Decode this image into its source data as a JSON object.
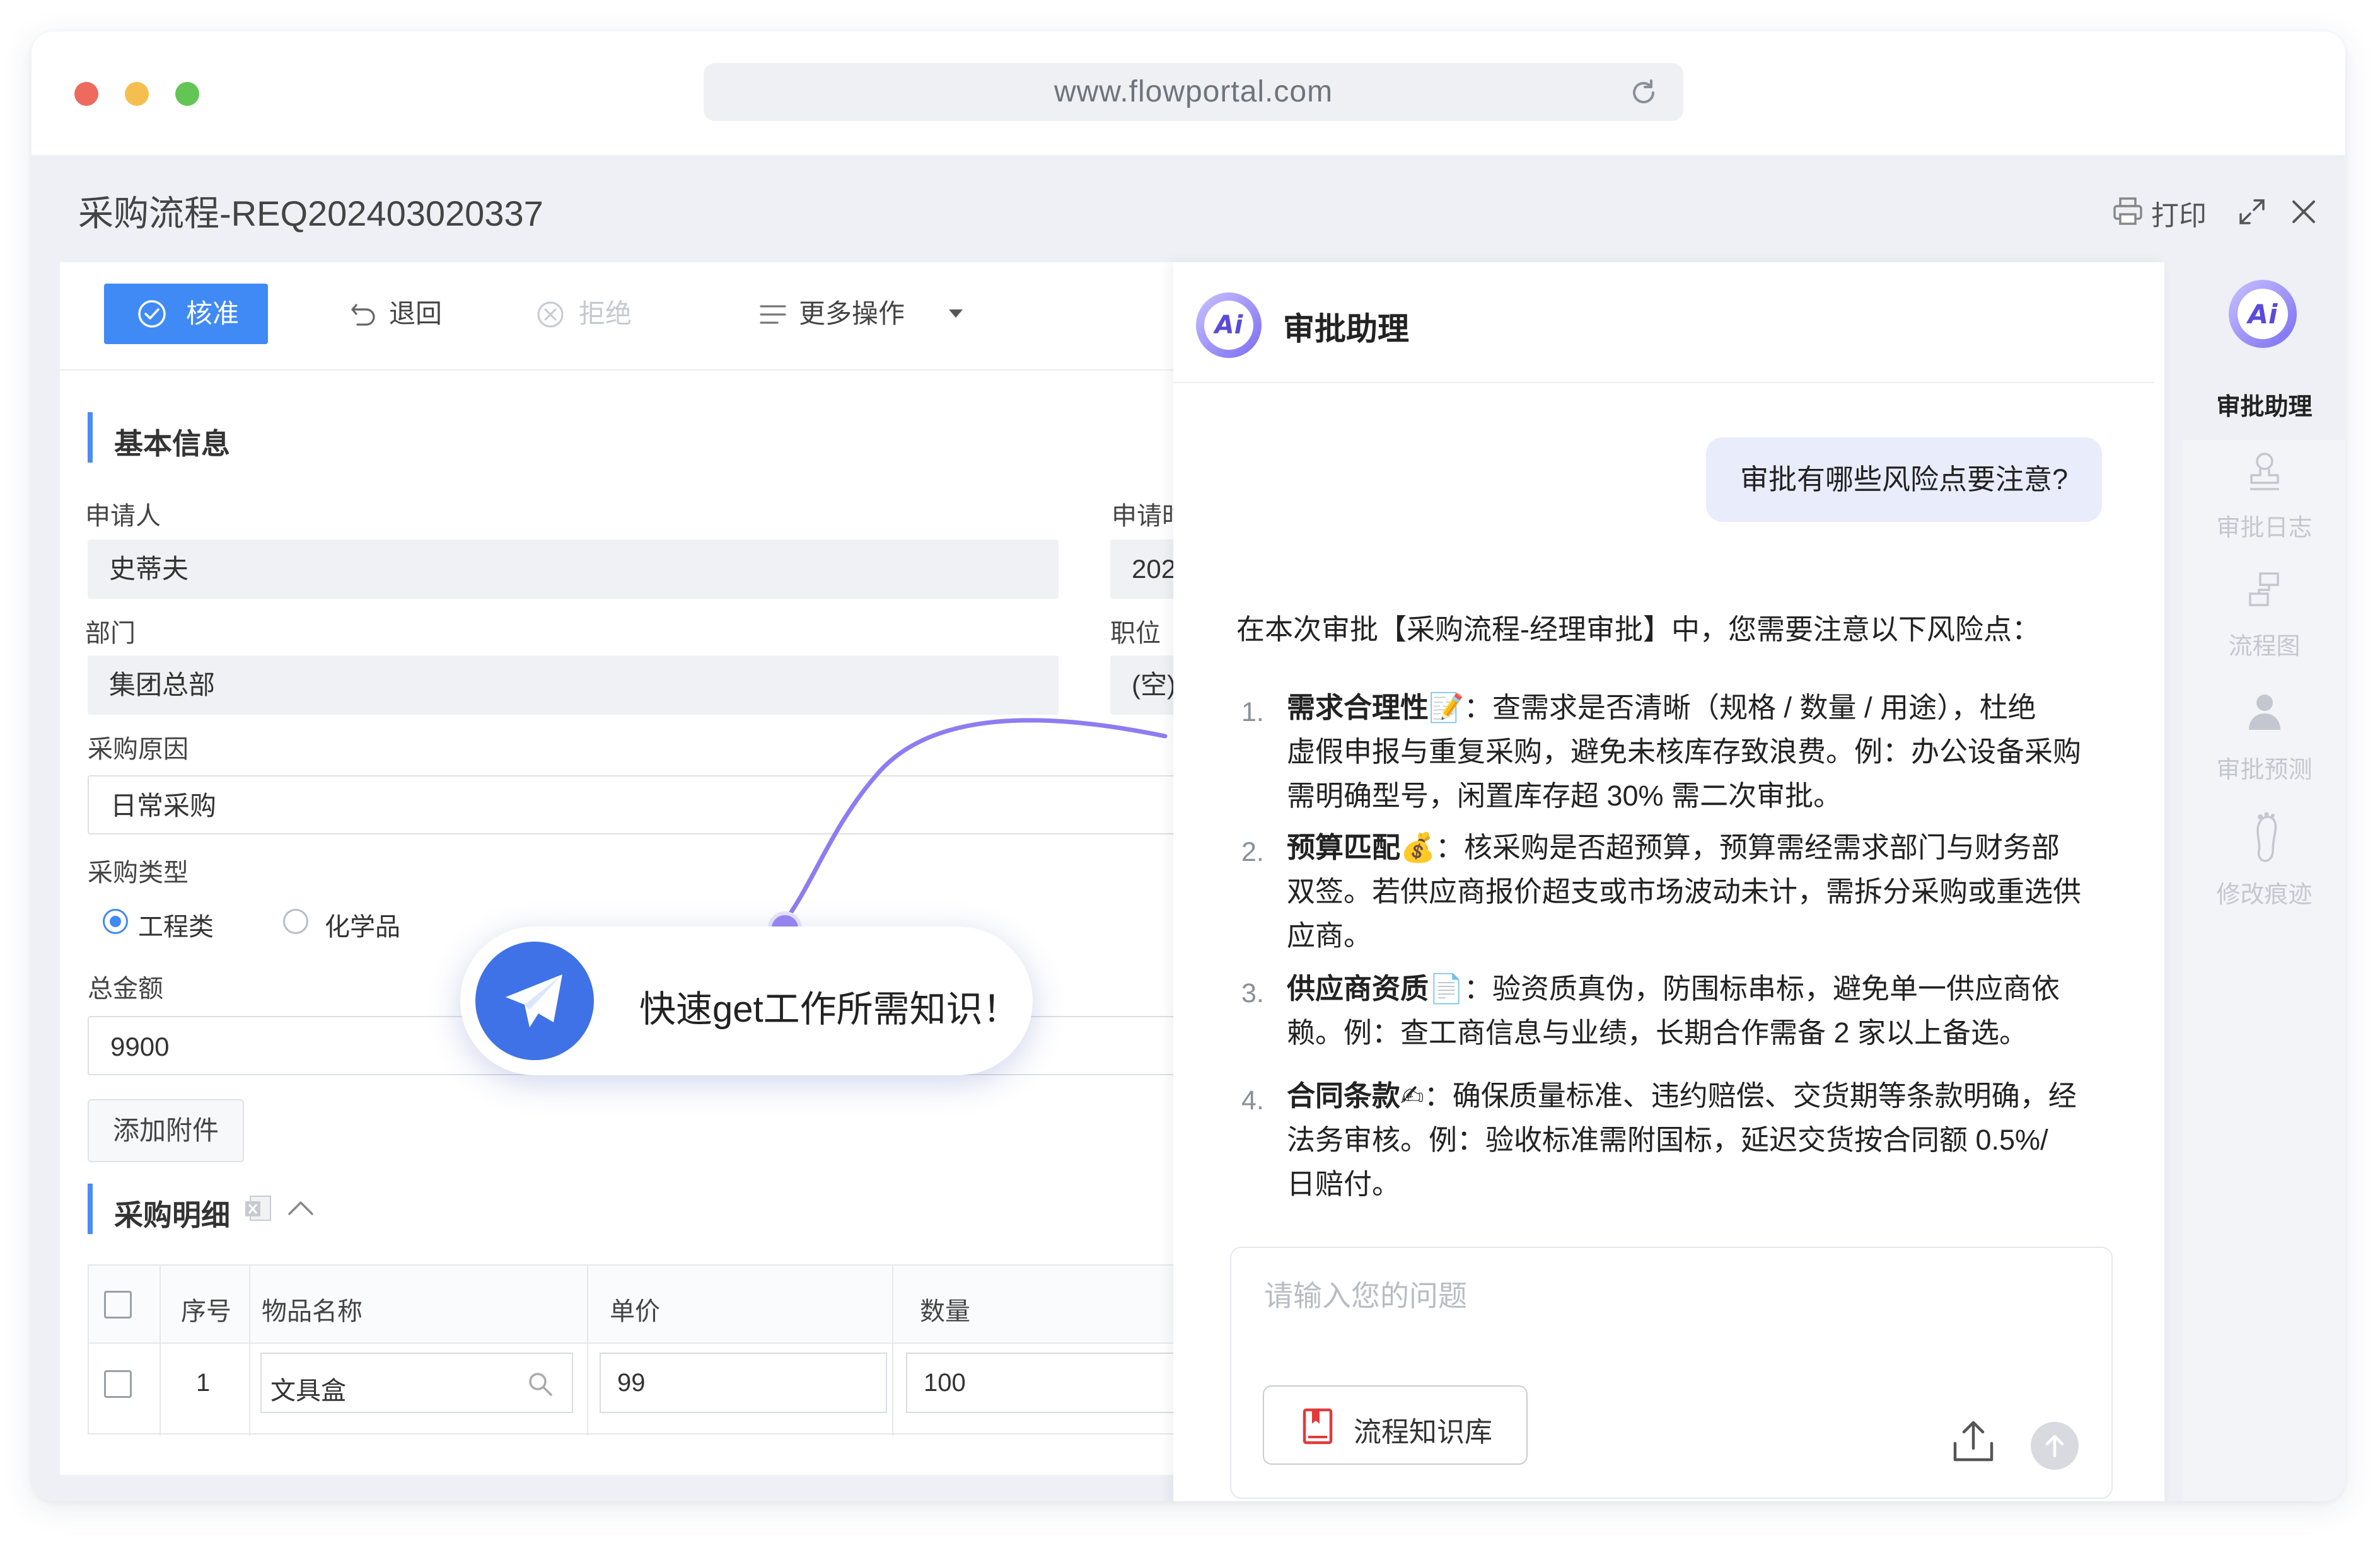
{
  "browser": {
    "url": "www.flowportal.com",
    "dot_colors": [
      "#ee6a5e",
      "#f5bf4f",
      "#62c554"
    ]
  },
  "page": {
    "title": "采购流程-REQ202403020337",
    "print_label": "打印"
  },
  "toolbar": {
    "approve": "核准",
    "return": "退回",
    "reject": "拒绝",
    "more": "更多操作"
  },
  "form": {
    "basic_section": "基本信息",
    "applicant_label": "申请人",
    "applicant_value": "史蒂夫",
    "apply_time_label": "申请时",
    "apply_time_value": "202",
    "dept_label": "部门",
    "dept_value": "集团总部",
    "position_label": "职位",
    "position_value": "(空)",
    "reason_label": "采购原因",
    "reason_value": "日常采购",
    "type_label": "采购类型",
    "type_options": [
      "工程类",
      "化学品"
    ],
    "type_selected": "工程类",
    "amount_label": "总金额",
    "amount_value": "9900",
    "attach_button": "添加附件",
    "detail_section": "采购明细",
    "table": {
      "headers": [
        "序号",
        "物品名称",
        "单价",
        "数量"
      ],
      "rows": [
        {
          "no": "1",
          "name": "文具盒",
          "price": "99",
          "qty": "100"
        }
      ]
    }
  },
  "popup": {
    "text": "快速get工作所需知识！"
  },
  "chat": {
    "logo_text": "Ai",
    "title": "审批助理",
    "user_question": "审批有哪些风险点要注意?",
    "answer_intro": "在本次审批【采购流程-经理审批】中，您需要注意以下风险点：",
    "items": [
      {
        "num": "1.",
        "title": "需求合理性",
        "emoji": "📝",
        "lines": [
          "：查需求是否清晰（规格 / 数量 / 用途），杜绝",
          "虚假申报与重复采购，避免未核库存致浪费。例：办公设备采购",
          "需明确型号，闲置库存超 30% 需二次审批。"
        ]
      },
      {
        "num": "2.",
        "title": "预算匹配",
        "emoji": "💰",
        "lines": [
          "：核采购是否超预算，预算需经需求部门与财务部",
          "双签。若供应商报价超支或市场波动未计，需拆分采购或重选供",
          "应商。"
        ]
      },
      {
        "num": "3.",
        "title": "供应商资质",
        "emoji": "📄",
        "lines": [
          "：验资质真伪，防围标串标，避免单一供应商依",
          "赖。例：查工商信息与业绩，长期合作需备 2 家以上备选。"
        ]
      },
      {
        "num": "4.",
        "title": "合同条款",
        "emoji": "✍",
        "lines": [
          "：确保质量标准、违约赔偿、交货期等条款明确，经",
          "法务审核。例：验收标准需附国标，延迟交货按合同额 0.5%/",
          "日赔付。"
        ]
      }
    ],
    "input_placeholder": "请输入您的问题",
    "kb_button": "流程知识库"
  },
  "rightbar": {
    "items": [
      "审批助理",
      "审批日志",
      "流程图",
      "审批预测",
      "修改痕迹"
    ]
  },
  "colors": {
    "accent": "#3f8af5",
    "ai_purple": "#7a6cf2",
    "curve": "#8f7bf2"
  }
}
